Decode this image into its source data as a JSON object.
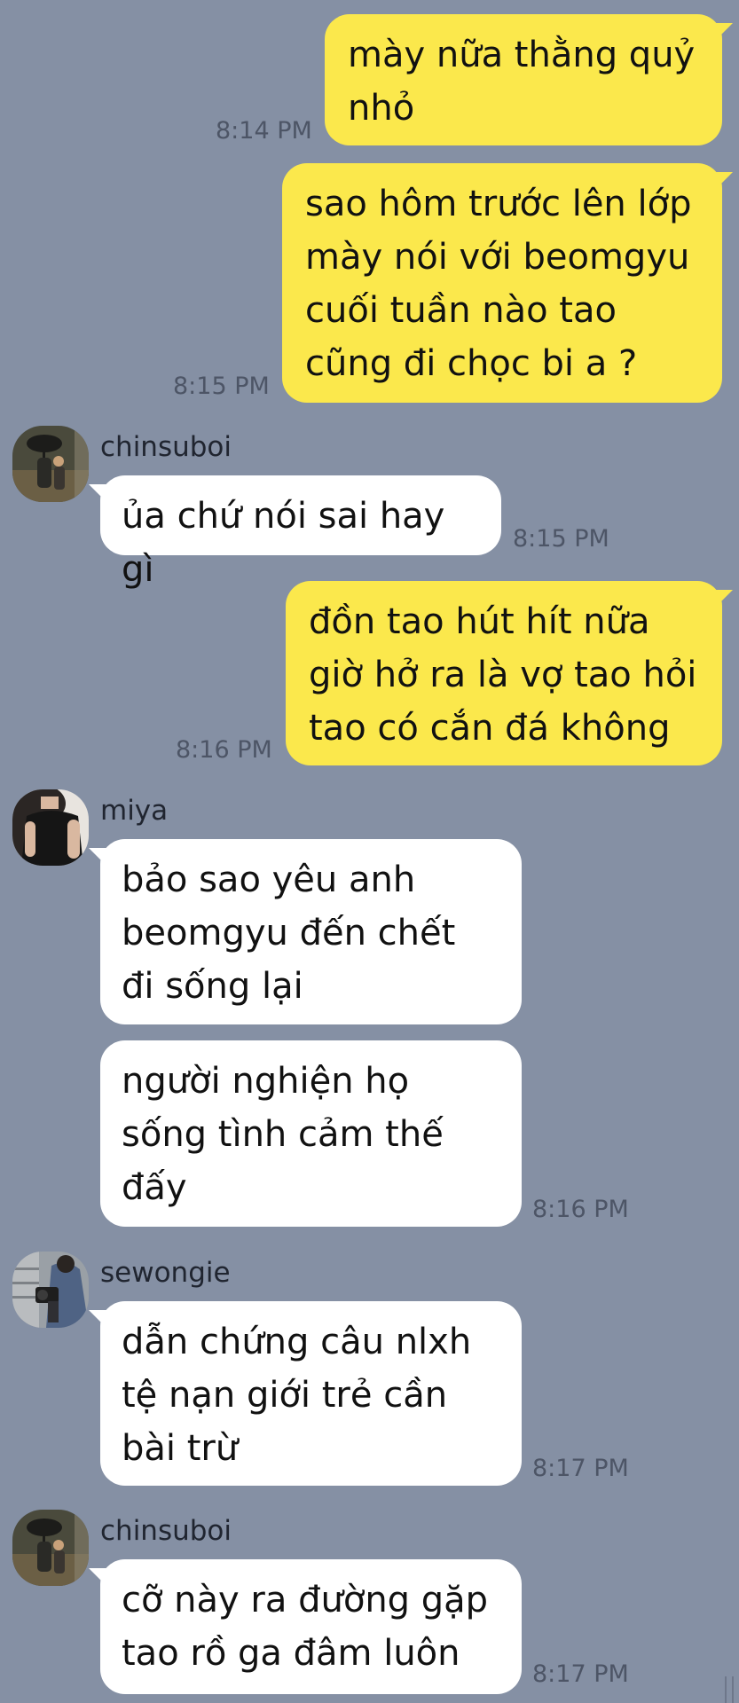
{
  "chat": {
    "messages": [
      {
        "text": "mày nữa thằng quỷ\nnhỏ",
        "time": "8:14 PM"
      },
      {
        "text": "sao hôm trước lên lớp\nmày nói với beomgyu\ncuối tuần nào tao\ncũng đi chọc bi a ?",
        "time": "8:15 PM"
      },
      {
        "sender": "chinsuboi",
        "text": "ủa chứ nói sai hay gì",
        "time": "8:15 PM"
      },
      {
        "text": "đồn tao hút hít nữa\ngiờ hở ra là vợ tao hỏi\ntao có cắn đá không",
        "time": "8:16 PM"
      },
      {
        "sender": "miya",
        "text": "bảo sao yêu anh\nbeomgyu đến chết\nđi sống lại"
      },
      {
        "text": "người nghiện họ\nsống tình cảm thế\nđấy",
        "time": "8:16 PM"
      },
      {
        "sender": "sewongie",
        "text": "dẫn chứng câu nlxh\ntệ nạn giới trẻ cần\nbài trừ",
        "time": "8:17 PM"
      },
      {
        "sender": "chinsuboi",
        "text": "cỡ này ra đường gặp\ntao rồ ga đâm luôn",
        "time": "8:17 PM"
      }
    ]
  },
  "colors": {
    "background": "#8590a4",
    "outgoing_bubble": "#fbe84c",
    "incoming_bubble": "#ffffff"
  },
  "icons": [
    "avatar-chinsuboi",
    "avatar-miya",
    "avatar-sewongie"
  ]
}
